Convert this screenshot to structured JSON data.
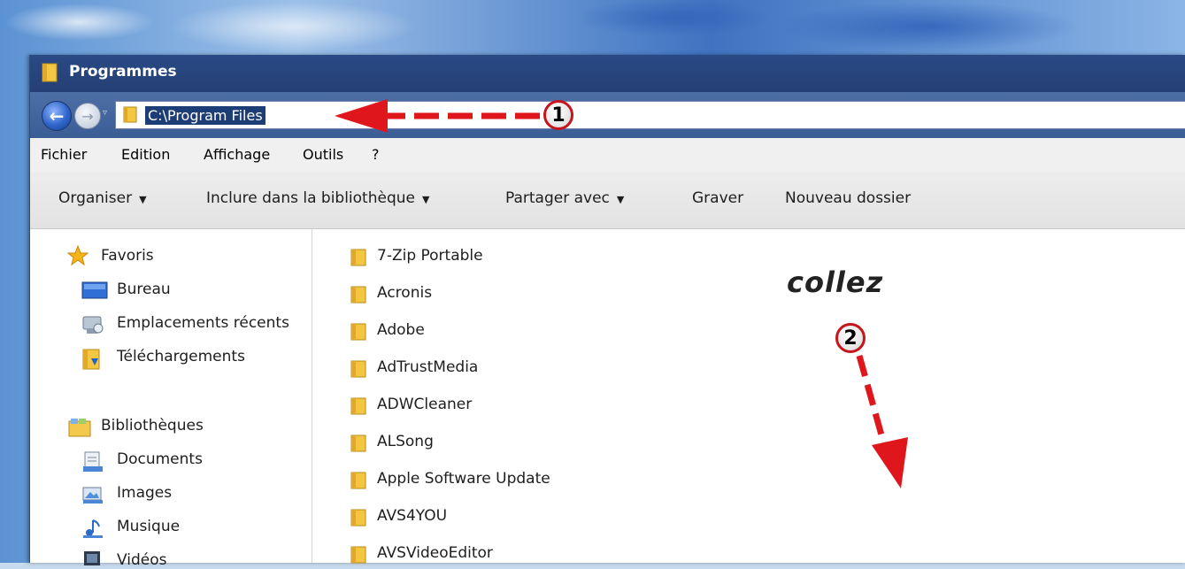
{
  "window": {
    "title": "Programmes"
  },
  "address": {
    "path": "C:\\Program Files"
  },
  "menu": [
    "Fichier",
    "Edition",
    "Affichage",
    "Outils",
    "?"
  ],
  "commands": {
    "organize": "Organiser",
    "include": "Inclure dans la bibliothèque",
    "share": "Partager avec",
    "burn": "Graver",
    "new_folder": "Nouveau dossier"
  },
  "sidebar": {
    "favorites": "Favoris",
    "desktop": "Bureau",
    "recent": "Emplacements récents",
    "downloads": "Téléchargements",
    "libraries": "Bibliothèques",
    "documents": "Documents",
    "images": "Images",
    "music": "Musique",
    "videos": "Vidéos"
  },
  "folders": [
    "7-Zip Portable",
    "Acronis",
    "Adobe",
    "AdTrustMedia",
    "ADWCleaner",
    "ALSong",
    "Apple Software Update",
    "AVS4YOU",
    "AVSVideoEditor"
  ],
  "annotations": {
    "step1": "1",
    "step2": "2",
    "paste_hint": "collez"
  },
  "colors": {
    "arrow": "#e0161d",
    "title_bar": "#2a4a86",
    "selection": "#1c3d76"
  }
}
